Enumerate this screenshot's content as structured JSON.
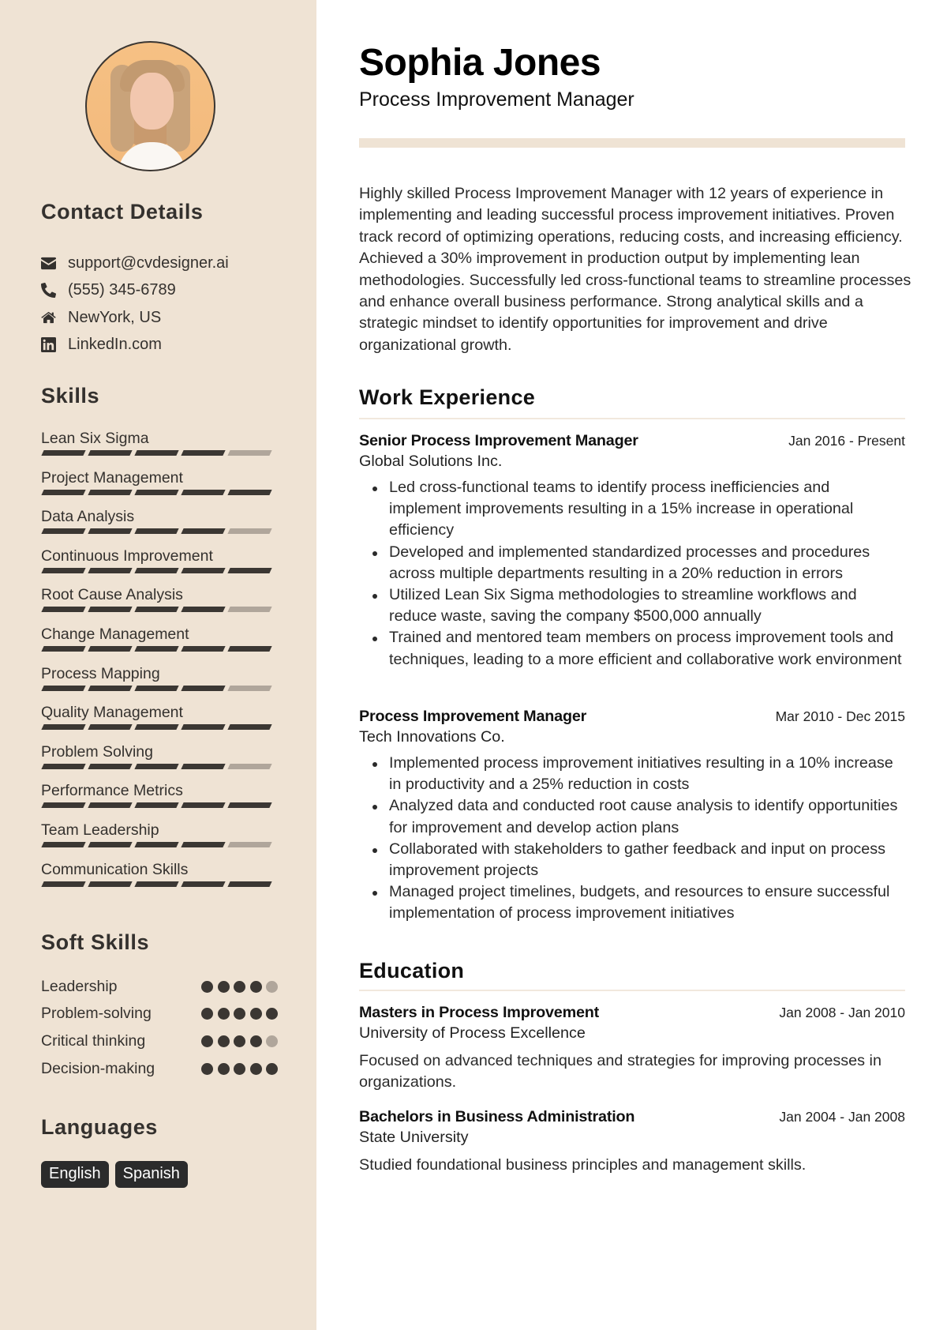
{
  "profile": {
    "name": "Sophia Jones",
    "title": "Process Improvement Manager",
    "photo_alt": "Profile photo of Sophia Jones"
  },
  "colors": {
    "sidebar_bg": "#efe3d4",
    "dark": "#3b3733",
    "muted": "#b0a69b",
    "badge_bg": "#2b2b2b"
  },
  "contact": {
    "heading": "Contact Details",
    "items": [
      {
        "icon": "envelope-icon",
        "text": "support@cvdesigner.ai"
      },
      {
        "icon": "phone-icon",
        "text": "(555) 345-6789"
      },
      {
        "icon": "home-icon",
        "text": "NewYork, US"
      },
      {
        "icon": "linkedin-icon",
        "text": "LinkedIn.com"
      }
    ]
  },
  "skills": {
    "heading": "Skills",
    "max": 5,
    "items": [
      {
        "name": "Lean Six Sigma",
        "level": 4
      },
      {
        "name": "Project Management",
        "level": 5
      },
      {
        "name": "Data Analysis",
        "level": 4
      },
      {
        "name": "Continuous Improvement",
        "level": 5
      },
      {
        "name": "Root Cause Analysis",
        "level": 4
      },
      {
        "name": "Change Management",
        "level": 5
      },
      {
        "name": "Process Mapping",
        "level": 4
      },
      {
        "name": "Quality Management",
        "level": 5
      },
      {
        "name": "Problem Solving",
        "level": 4
      },
      {
        "name": "Performance Metrics",
        "level": 5
      },
      {
        "name": "Team Leadership",
        "level": 4
      },
      {
        "name": "Communication Skills",
        "level": 5
      }
    ]
  },
  "soft_skills": {
    "heading": "Soft Skills",
    "max": 5,
    "items": [
      {
        "name": "Leadership",
        "level": 4
      },
      {
        "name": "Problem-solving",
        "level": 5
      },
      {
        "name": "Critical thinking",
        "level": 4
      },
      {
        "name": "Decision-making",
        "level": 5
      }
    ]
  },
  "languages": {
    "heading": "Languages",
    "items": [
      "English",
      "Spanish"
    ]
  },
  "summary": "Highly skilled Process Improvement Manager with 12 years of experience in implementing and leading successful process improvement initiatives. Proven track record of optimizing operations, reducing costs, and increasing efficiency. Achieved a 30% improvement in production output by implementing lean methodologies. Successfully led cross-functional teams to streamline processes and enhance overall business performance. Strong analytical skills and a strategic mindset to identify opportunities for improvement and drive organizational growth.",
  "work": {
    "heading": "Work Experience",
    "jobs": [
      {
        "title": "Senior Process Improvement Manager",
        "company": "Global Solutions Inc.",
        "dates": "Jan 2016 - Present",
        "bullets": [
          "Led cross-functional teams to identify process inefficiencies and implement improvements resulting in a 15% increase in operational efficiency",
          "Developed and implemented standardized processes and procedures across multiple departments resulting in a 20% reduction in errors",
          "Utilized Lean Six Sigma methodologies to streamline workflows and reduce waste, saving the company $500,000 annually",
          "Trained and mentored team members on process improvement tools and techniques, leading to a more efficient and collaborative work environment"
        ]
      },
      {
        "title": "Process Improvement Manager",
        "company": "Tech Innovations Co.",
        "dates": "Mar 2010 - Dec 2015",
        "bullets": [
          "Implemented process improvement initiatives resulting in a 10% increase in productivity and a 25% reduction in costs",
          "Analyzed data and conducted root cause analysis to identify opportunities for improvement and develop action plans",
          "Collaborated with stakeholders to gather feedback and input on process improvement projects",
          "Managed project timelines, budgets, and resources to ensure successful implementation of process improvement initiatives"
        ]
      }
    ]
  },
  "education": {
    "heading": "Education",
    "items": [
      {
        "degree": "Masters in Process Improvement",
        "school": "University of Process Excellence",
        "dates": "Jan 2008 - Jan 2010",
        "description": "Focused on advanced techniques and strategies for improving processes in organizations."
      },
      {
        "degree": "Bachelors in Business Administration",
        "school": "State University",
        "dates": "Jan 2004 - Jan 2008",
        "description": "Studied foundational business principles and management skills."
      }
    ]
  }
}
